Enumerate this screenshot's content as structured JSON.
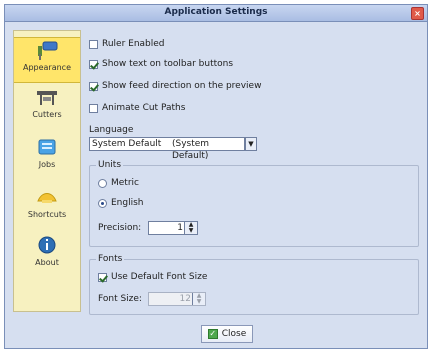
{
  "window": {
    "title": "Application Settings",
    "close_symbol": "×"
  },
  "sidebar": {
    "items": [
      {
        "label": "Appearance",
        "icon": "paint-roller-icon",
        "selected": true
      },
      {
        "label": "Cutters",
        "icon": "cutter-icon",
        "selected": false
      },
      {
        "label": "Jobs",
        "icon": "jobs-icon",
        "selected": false
      },
      {
        "label": "Shortcuts",
        "icon": "shortcuts-icon",
        "selected": false
      },
      {
        "label": "About",
        "icon": "info-icon",
        "selected": false
      }
    ]
  },
  "appearance": {
    "ruler_enabled": {
      "label": "Ruler Enabled",
      "checked": false
    },
    "show_text_toolbar": {
      "label": "Show text on toolbar buttons",
      "checked": true
    },
    "show_feed_direction": {
      "label": "Show feed direction on the preview",
      "checked": true
    },
    "animate_cut_paths": {
      "label": "Animate Cut Paths",
      "checked": false
    },
    "language": {
      "label": "Language",
      "value_left": "System Default",
      "value_right": "(System Default)",
      "arrow": "▼"
    },
    "units": {
      "legend": "Units",
      "options": [
        {
          "label": "Metric",
          "selected": false
        },
        {
          "label": "English",
          "selected": true
        }
      ],
      "precision_label": "Precision:",
      "precision_value": "1"
    },
    "fonts": {
      "legend": "Fonts",
      "use_default_font": {
        "label": "Use Default Font Size",
        "checked": true
      },
      "font_size_label": "Font Size:",
      "font_size_value": "12"
    }
  },
  "footer": {
    "close_label": "Close",
    "close_icon": "✓"
  },
  "colors": {
    "window_bg": "#d6dff0",
    "sidebar_bg": "#f7f1c0",
    "selected_bg": "#ffe56a"
  }
}
